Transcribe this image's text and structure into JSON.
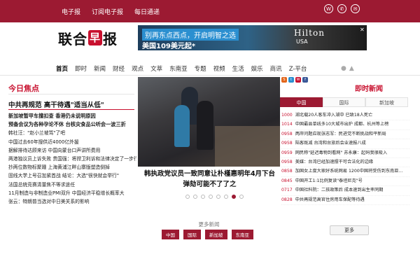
{
  "topbar": {
    "links": [
      "电子报",
      "订阅电子报",
      "每日通递"
    ],
    "social": [
      "weibo-icon",
      "wechat-icon",
      "chat-icon"
    ]
  },
  "brand": {
    "name_part1": "联合",
    "name_mark": "早",
    "name_part2": "报"
  },
  "ad": {
    "line1": "别再东点西点，开启明智之选",
    "line2": "美国109美元起*",
    "brand": "Hilton",
    "brand_sub": "USA",
    "close": "✕"
  },
  "nav": {
    "items": [
      "首页",
      "即时",
      "新闻",
      "财经",
      "观点",
      "文萃",
      "东南亚",
      "专题",
      "视频",
      "生活",
      "娱乐",
      "商讯",
      "Z-平台"
    ]
  },
  "left": {
    "section_title": "今日焦点",
    "lead": "中共再规范 高干待遇\"适当从低\"",
    "items": [
      {
        "text": "新加坡暂甲车撞扣查 香港仍未说明原因",
        "bold": true
      },
      {
        "text": "预备会议为各种孕论不休 台核灾食品公听会一波三折",
        "bold": true
      },
      {
        "text": "韩社汪：\"赵小兰坡骂\"了吧",
        "bold": false
      },
      {
        "text": "中国过去60年搜供近4000亿外援",
        "bold": false
      },
      {
        "text": "据解排待达顾来访 中国向蒙台口声讲所费用",
        "bold": false
      },
      {
        "text": "两港独议员上诉失败 贵国强：将捍卫利诉和法律决定了一步行动",
        "bold": false
      },
      {
        "text": "抄两位数物标聚踵 上海黄浦江畔山寨版塑造倒掉",
        "bold": false
      },
      {
        "text": "固线大学上号召加紧首战 结论：大选\"很快就会举行\"",
        "bold": false
      },
      {
        "text": "法国总统竞赛清董焦不等求途任",
        "bold": false
      },
      {
        "text": "11月制造与非制造业PMI双升 中国经济平稳增长概率大",
        "bold": false
      },
      {
        "text": "张云：特朗普当选对中日美关系的影响",
        "bold": false
      }
    ]
  },
  "main": {
    "caption": "韩执政党议员一致同意让朴槿惠明年4月下台 弹劾可能不了了之",
    "more_title": "更多新闻",
    "tags": [
      "中国",
      "国际",
      "新加坡",
      "东南亚"
    ]
  },
  "right": {
    "title": "即时新闻",
    "tabs": [
      "中国",
      "国际",
      "新加坡"
    ],
    "feed": [
      {
        "time": "1000",
        "text": "湖北载20人客车冲入湖中 已致18人死亡"
      },
      {
        "time": "1014",
        "text": "中国最县单线多10大城市出炉 成都、杭州等上榜"
      },
      {
        "time": "0958",
        "text": "两岸问题应现张志军：民进党不断挑战和平新局"
      },
      {
        "time": "0958",
        "text": "陆客既减 台湾和台旅后会业速报八成"
      },
      {
        "time": "0959",
        "text": "网民称\"延迟毒物到看网\"  苏永康：起码我很吸入"
      },
      {
        "time": "0958",
        "text": "美媒：台湾已经加速摆干可合法化的边缘"
      },
      {
        "time": "0858",
        "text": "加国女上度大家好系统网易 1200中国将受伤到东南亚..."
      },
      {
        "time": "0845",
        "text": "中国开工1:1比例复读\"泰坦尼克\"号"
      },
      {
        "time": "0717",
        "text": "中国社科院：二孩政策后 成本速到出生率同期"
      },
      {
        "time": "0828",
        "text": "中共再规范高官住房用车保配等待遇"
      }
    ],
    "more_button": "更多"
  }
}
